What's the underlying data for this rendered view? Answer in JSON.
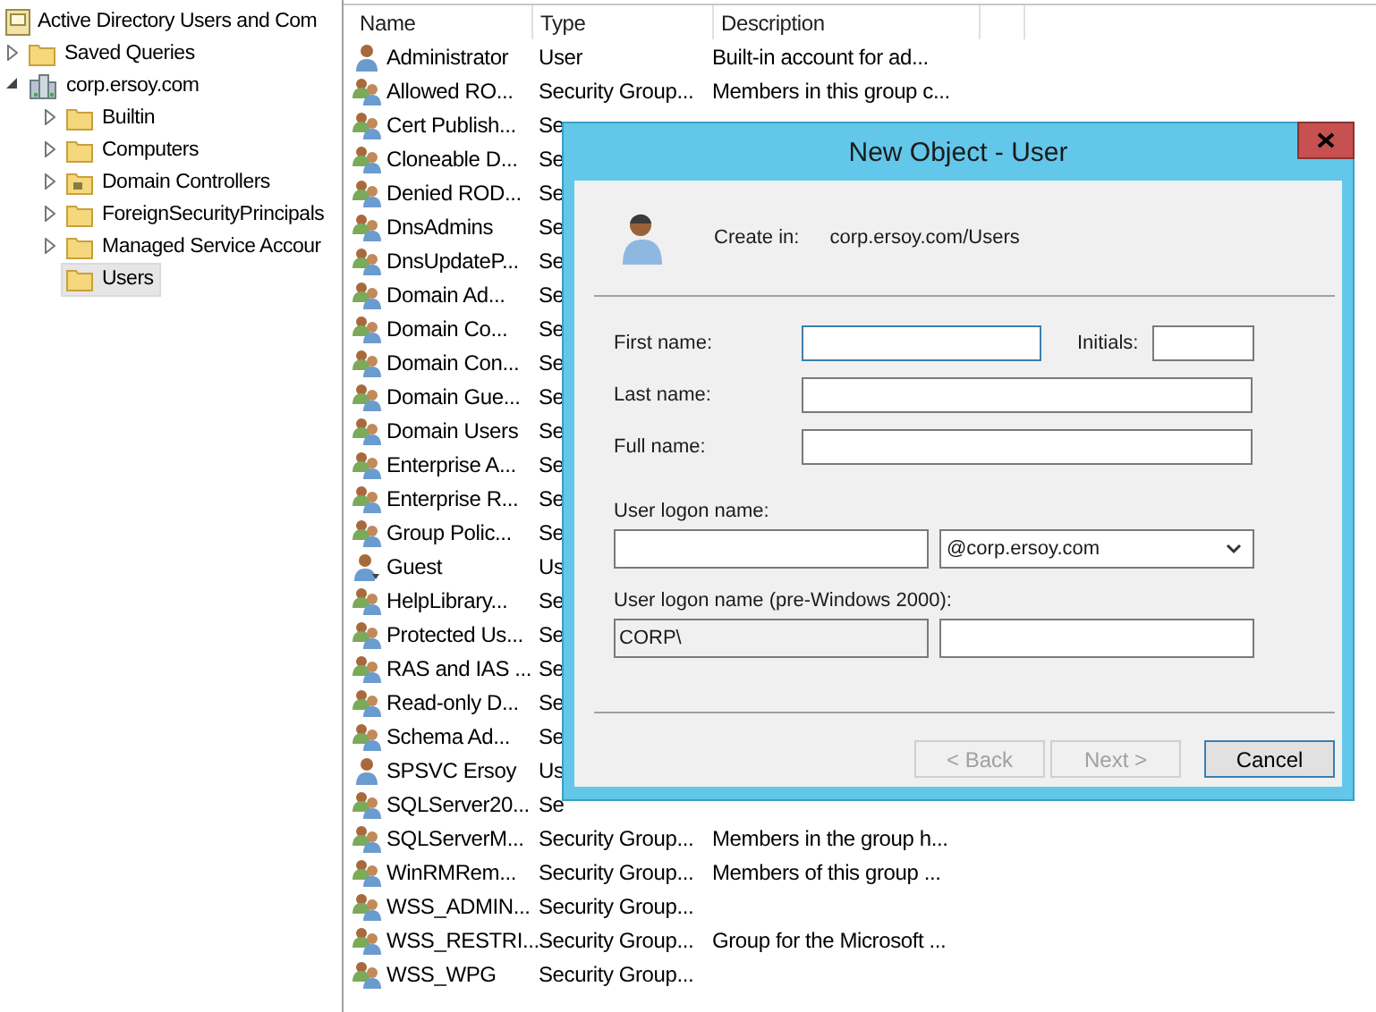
{
  "tree": {
    "root": "Active Directory Users and Com",
    "items": [
      {
        "label": "Saved Queries",
        "kind": "folder",
        "expandable": true,
        "expanded": false,
        "selected": false
      },
      {
        "label": "corp.ersoy.com",
        "kind": "domain",
        "expandable": true,
        "expanded": true,
        "selected": false,
        "children": [
          {
            "label": "Builtin",
            "kind": "folder",
            "expandable": true,
            "expanded": false,
            "selected": false
          },
          {
            "label": "Computers",
            "kind": "folder",
            "expandable": true,
            "expanded": false,
            "selected": false
          },
          {
            "label": "Domain Controllers",
            "kind": "ou",
            "expandable": true,
            "expanded": false,
            "selected": false
          },
          {
            "label": "ForeignSecurityPrincipals",
            "kind": "folder",
            "expandable": true,
            "expanded": false,
            "selected": false
          },
          {
            "label": "Managed Service Accour",
            "kind": "folder",
            "expandable": true,
            "expanded": false,
            "selected": false
          },
          {
            "label": "Users",
            "kind": "folder",
            "expandable": false,
            "selected": true
          }
        ]
      }
    ]
  },
  "list": {
    "columns": [
      "Name",
      "Type",
      "Description"
    ],
    "rows": [
      {
        "kind": "user",
        "name": "Administrator",
        "type": "User",
        "description": "Built-in account for ad..."
      },
      {
        "kind": "group",
        "name": "Allowed RO...",
        "type": "Security Group...",
        "description": "Members in this group c..."
      },
      {
        "kind": "group",
        "name": "Cert Publish...",
        "type": "Se"
      },
      {
        "kind": "group",
        "name": "Cloneable D...",
        "type": "Se"
      },
      {
        "kind": "group",
        "name": "Denied ROD...",
        "type": "Se"
      },
      {
        "kind": "group",
        "name": "DnsAdmins",
        "type": "Se"
      },
      {
        "kind": "group",
        "name": "DnsUpdateP...",
        "type": "Se"
      },
      {
        "kind": "group",
        "name": "Domain Ad...",
        "type": "Se"
      },
      {
        "kind": "group",
        "name": "Domain Co...",
        "type": "Se"
      },
      {
        "kind": "group",
        "name": "Domain Con...",
        "type": "Se"
      },
      {
        "kind": "group",
        "name": "Domain Gue...",
        "type": "Se"
      },
      {
        "kind": "group",
        "name": "Domain Users",
        "type": "Se"
      },
      {
        "kind": "group",
        "name": "Enterprise A...",
        "type": "Se"
      },
      {
        "kind": "group",
        "name": "Enterprise R...",
        "type": "Se"
      },
      {
        "kind": "group",
        "name": "Group Polic...",
        "type": "Se"
      },
      {
        "kind": "guest",
        "name": "Guest",
        "type": "Us"
      },
      {
        "kind": "group",
        "name": "HelpLibrary...",
        "type": "Se"
      },
      {
        "kind": "group",
        "name": "Protected Us...",
        "type": "Se"
      },
      {
        "kind": "group",
        "name": "RAS and IAS ...",
        "type": "Se"
      },
      {
        "kind": "group",
        "name": "Read-only D...",
        "type": "Se"
      },
      {
        "kind": "group",
        "name": "Schema Ad...",
        "type": "Se"
      },
      {
        "kind": "user",
        "name": "SPSVC Ersoy",
        "type": "Us"
      },
      {
        "kind": "group",
        "name": "SQLServer20...",
        "type": "Se"
      },
      {
        "kind": "group",
        "name": "SQLServerM...",
        "type": "Security Group...",
        "description": "Members in the group h..."
      },
      {
        "kind": "group",
        "name": "WinRMRem...",
        "type": "Security Group...",
        "description": "Members of this group ..."
      },
      {
        "kind": "group",
        "name": "WSS_ADMIN...",
        "type": "Security Group..."
      },
      {
        "kind": "group",
        "name": "WSS_RESTRI...",
        "type": "Security Group...",
        "description": "Group for the Microsoft ..."
      },
      {
        "kind": "group",
        "name": "WSS_WPG",
        "type": "Security Group..."
      }
    ]
  },
  "dialog": {
    "title": "New Object - User",
    "create_in_label": "Create in:",
    "create_in_path": "corp.ersoy.com/Users",
    "first_name": {
      "label": "First name:",
      "focused": true
    },
    "initials": {
      "label": "Initials:",
      "focused": false
    },
    "last_name": {
      "label": "Last name:",
      "focused": false
    },
    "full_name": {
      "label": "Full name:",
      "focused": false
    },
    "logon_name": {
      "label": "User logon name:",
      "focused": false
    },
    "upn_suffix": {
      "value": "@corp.ersoy.com"
    },
    "pre2000": {
      "label": "User logon name (pre-Windows 2000):",
      "domain": "CORP\\",
      "focused": false
    },
    "buttons": [
      {
        "label": "< Back",
        "disabled": true,
        "default": false
      },
      {
        "label": "Next >",
        "disabled": true,
        "default": false
      },
      {
        "label": "Cancel",
        "disabled": false,
        "default": true
      }
    ]
  }
}
